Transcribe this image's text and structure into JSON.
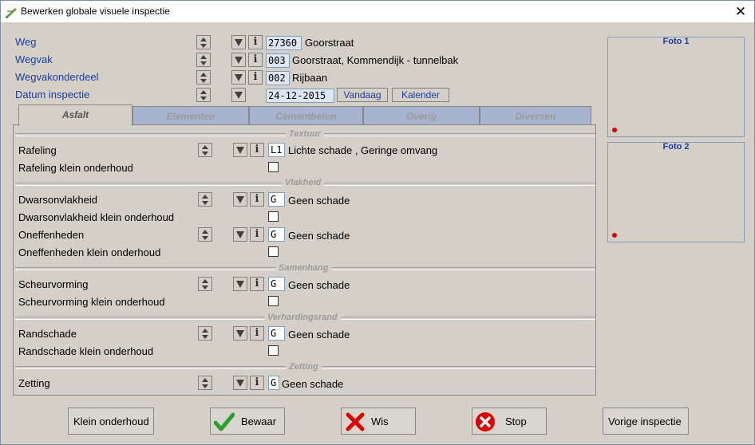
{
  "window": {
    "title": "Bewerken globale visuele inspectie",
    "close_glyph": "✕"
  },
  "header": {
    "weg": {
      "label": "Weg",
      "code": "27360",
      "value": "Goorstraat"
    },
    "wegvak": {
      "label": "Wegvak",
      "code": "003",
      "value": "Goorstraat, Kommendijk - tunnelbak"
    },
    "wegvakonderdeel": {
      "label": "Wegvakonderdeel",
      "code": "002",
      "value": "Rijbaan"
    },
    "datum": {
      "label": "Datum inspectie",
      "value": "24-12-2015",
      "today_label": "Vandaag",
      "calendar_label": "Kalender"
    }
  },
  "tabs": [
    {
      "label": "Asfalt",
      "active": true
    },
    {
      "label": "Elementen",
      "active": false
    },
    {
      "label": "Cementbeton",
      "active": false
    },
    {
      "label": "Overig",
      "active": false
    },
    {
      "label": "Diversen",
      "active": false
    }
  ],
  "sections": {
    "textuur": "Textuur",
    "vlakheid": "Vlakheid",
    "samenhang": "Samenhang",
    "verhardingsrand": "Verhardingsrand",
    "zetting": "Zetting"
  },
  "rows": {
    "rafeling": {
      "label": "Rafeling",
      "code": "L1",
      "value": "Lichte schade   , Geringe omvang"
    },
    "rafeling_ko": {
      "label": "Rafeling klein onderhoud",
      "checked": false
    },
    "dwars": {
      "label": "Dwarsonvlakheid",
      "code": "G",
      "value": "Geen schade"
    },
    "dwars_ko": {
      "label": "Dwarsonvlakheid klein onderhoud",
      "checked": false
    },
    "oneff": {
      "label": "Oneffenheden",
      "code": "G",
      "value": "Geen schade"
    },
    "oneff_ko": {
      "label": "Oneffenheden klein onderhoud",
      "checked": false
    },
    "scheur": {
      "label": "Scheurvorming",
      "code": "G",
      "value": "Geen schade"
    },
    "scheur_ko": {
      "label": "Scheurvorming klein onderhoud",
      "checked": false
    },
    "rand": {
      "label": "Randschade",
      "code": "G",
      "value": "Geen schade"
    },
    "rand_ko": {
      "label": "Randschade klein onderhoud",
      "checked": false
    },
    "zetting": {
      "label": "Zetting",
      "code": "G",
      "value": "Geen schade"
    }
  },
  "photos": {
    "foto1": "Foto 1",
    "foto2": "Foto 2"
  },
  "buttons": {
    "klein_onderhoud": "Klein onderhoud",
    "bewaar": "Bewaar",
    "wis": "Wis",
    "stop": "Stop",
    "vorige": "Vorige inspectie"
  },
  "colors": {
    "label_blue": "#1d3d9e",
    "tab_inactive": "#a8b4cf",
    "accent_red": "#e00000",
    "check_green": "#2e9e2e"
  }
}
